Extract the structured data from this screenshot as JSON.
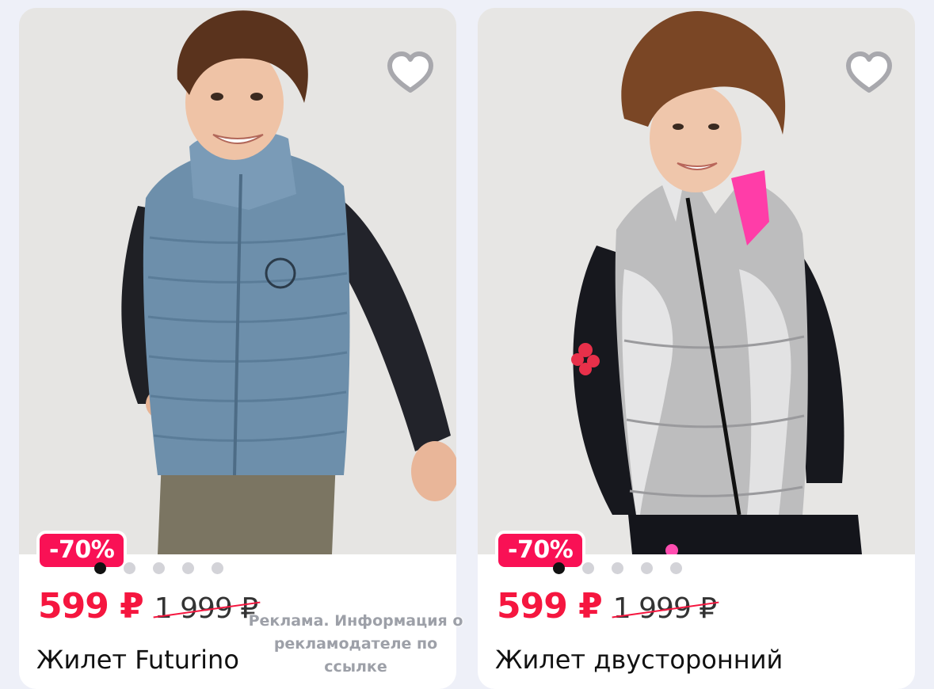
{
  "products": [
    {
      "title": "Жилет Futurino",
      "price": "599 ₽",
      "old_price": "1 999 ₽",
      "discount": "-70%",
      "images_count": 5,
      "active_image": 1,
      "favorite_icon": "heart-outline-icon",
      "photo": "boy-in-blue-puffer-vest"
    },
    {
      "title": "Жилет двусторонний",
      "price": "599 ₽",
      "old_price": "1 999 ₽",
      "discount": "-70%",
      "images_count": 5,
      "active_image": 1,
      "favorite_icon": "heart-outline-icon",
      "photo": "girl-in-silver-puffer-vest"
    }
  ],
  "ad_disclaimer": "Реклама. Информация о рекламодателе по ссылке",
  "colors": {
    "accent": "#f5163f",
    "badge": "#f91155",
    "background": "#eef0f8",
    "dot_active": "#111111",
    "dot_inactive": "#d3d3d8"
  }
}
